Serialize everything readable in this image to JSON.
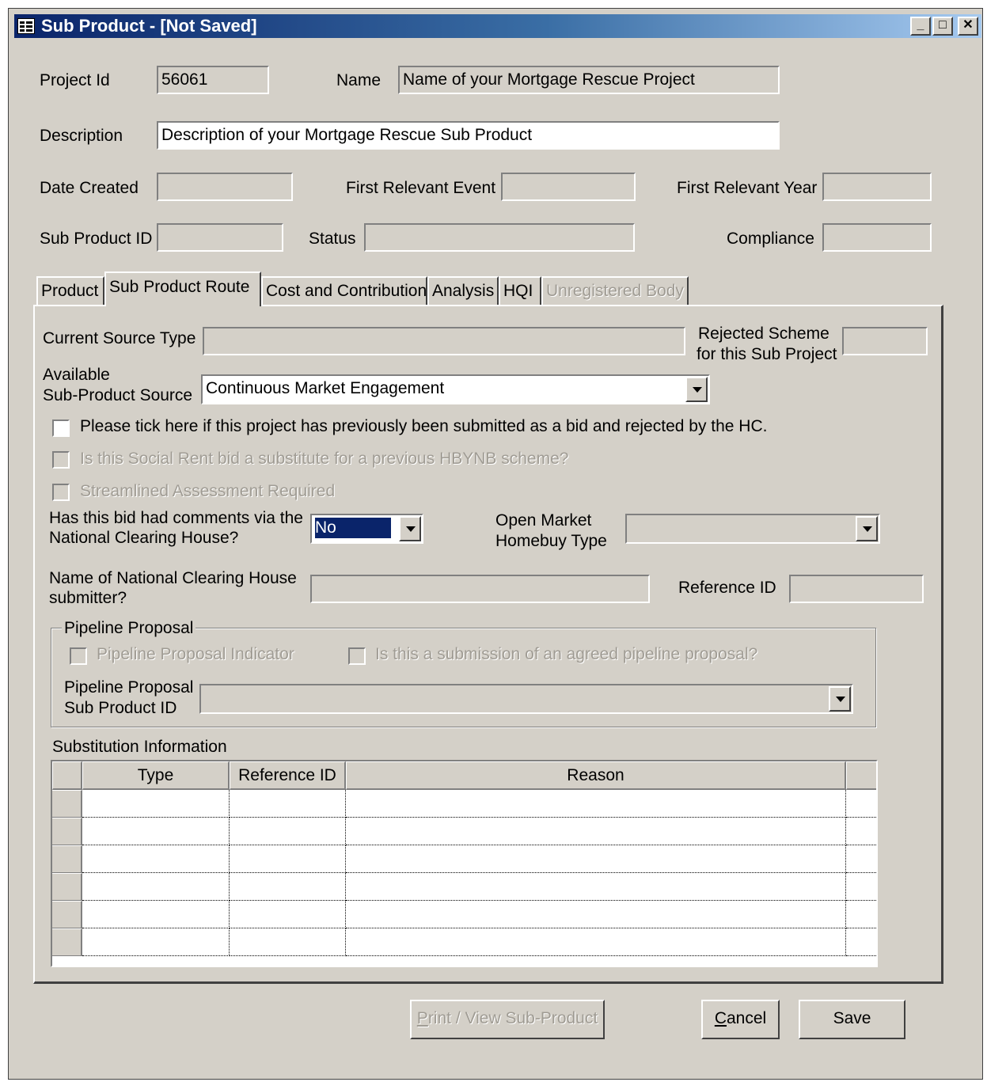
{
  "window": {
    "title": "Sub Product - [Not Saved]",
    "controls": [
      "_",
      "□",
      "✕"
    ]
  },
  "header": {
    "project_id_label": "Project Id",
    "project_id_value": "56061",
    "name_label": "Name",
    "name_value": "Name of your Mortgage Rescue Project",
    "description_label": "Description",
    "description_value": "Description of your Mortgage Rescue Sub Product",
    "date_created_label": "Date Created",
    "date_created_value": "",
    "first_relevant_event_label": "First Relevant Event",
    "first_relevant_event_value": "",
    "first_relevant_year_label": "First Relevant Year",
    "first_relevant_year_value": "",
    "sub_product_id_label": "Sub Product ID",
    "sub_product_id_value": "",
    "status_label": "Status",
    "status_value": "",
    "compliance_label": "Compliance",
    "compliance_value": ""
  },
  "tabs": {
    "product": "Product",
    "sub_product_route": "Sub Product Route",
    "cost_and_contribution": "Cost and Contribution",
    "analysis": "Analysis",
    "hqi": "HQI",
    "unregistered_body": "Unregistered Body",
    "active": "Sub Product Route"
  },
  "route": {
    "current_source_type_label": "Current Source Type",
    "current_source_type_value": "",
    "rejected_scheme_label_1": "Rejected Scheme",
    "rejected_scheme_label_2": "for this Sub Project",
    "rejected_scheme_value": "",
    "available_source_label_1": "Available",
    "available_source_label_2": "Sub-Product Source",
    "available_source_value": "Continuous Market Engagement",
    "chk_rejected_bid": "Please tick here if this project has previously been submitted as a bid and rejected by the HC.",
    "chk_social_rent": "Is this Social Rent bid a substitute for a previous HBYNB scheme?",
    "chk_streamlined": "Streamlined Assessment Required",
    "nch_comments_label_1": "Has this bid had comments via the",
    "nch_comments_label_2": "National Clearing House?",
    "nch_comments_value": "No",
    "open_market_label_1": "Open Market",
    "open_market_label_2": "Homebuy Type",
    "open_market_value": "",
    "nch_submitter_label_1": "Name of National Clearing House",
    "nch_submitter_label_2": "submitter?",
    "nch_submitter_value": "",
    "reference_id_label": "Reference ID",
    "reference_id_value": ""
  },
  "pipeline": {
    "group_label": "Pipeline Proposal",
    "indicator_label": "Pipeline Proposal Indicator",
    "agreed_label": "Is this a submission of an agreed  pipeline proposal?",
    "sub_product_id_label_1": "Pipeline Proposal",
    "sub_product_id_label_2": "Sub Product ID",
    "sub_product_id_value": ""
  },
  "substitution": {
    "label": "Substitution Information",
    "columns": [
      "Type",
      "Reference ID",
      "Reason"
    ],
    "rows": [
      [
        "",
        "",
        ""
      ],
      [
        "",
        "",
        ""
      ],
      [
        "",
        "",
        ""
      ],
      [
        "",
        "",
        ""
      ],
      [
        "",
        "",
        ""
      ],
      [
        "",
        "",
        ""
      ]
    ]
  },
  "buttons": {
    "print": "Print / View Sub-Product",
    "print_accel": "P",
    "print_rest": "rint / View Sub-Product",
    "cancel": "Cancel",
    "cancel_accel": "C",
    "cancel_rest": "ancel",
    "save": "Save"
  }
}
